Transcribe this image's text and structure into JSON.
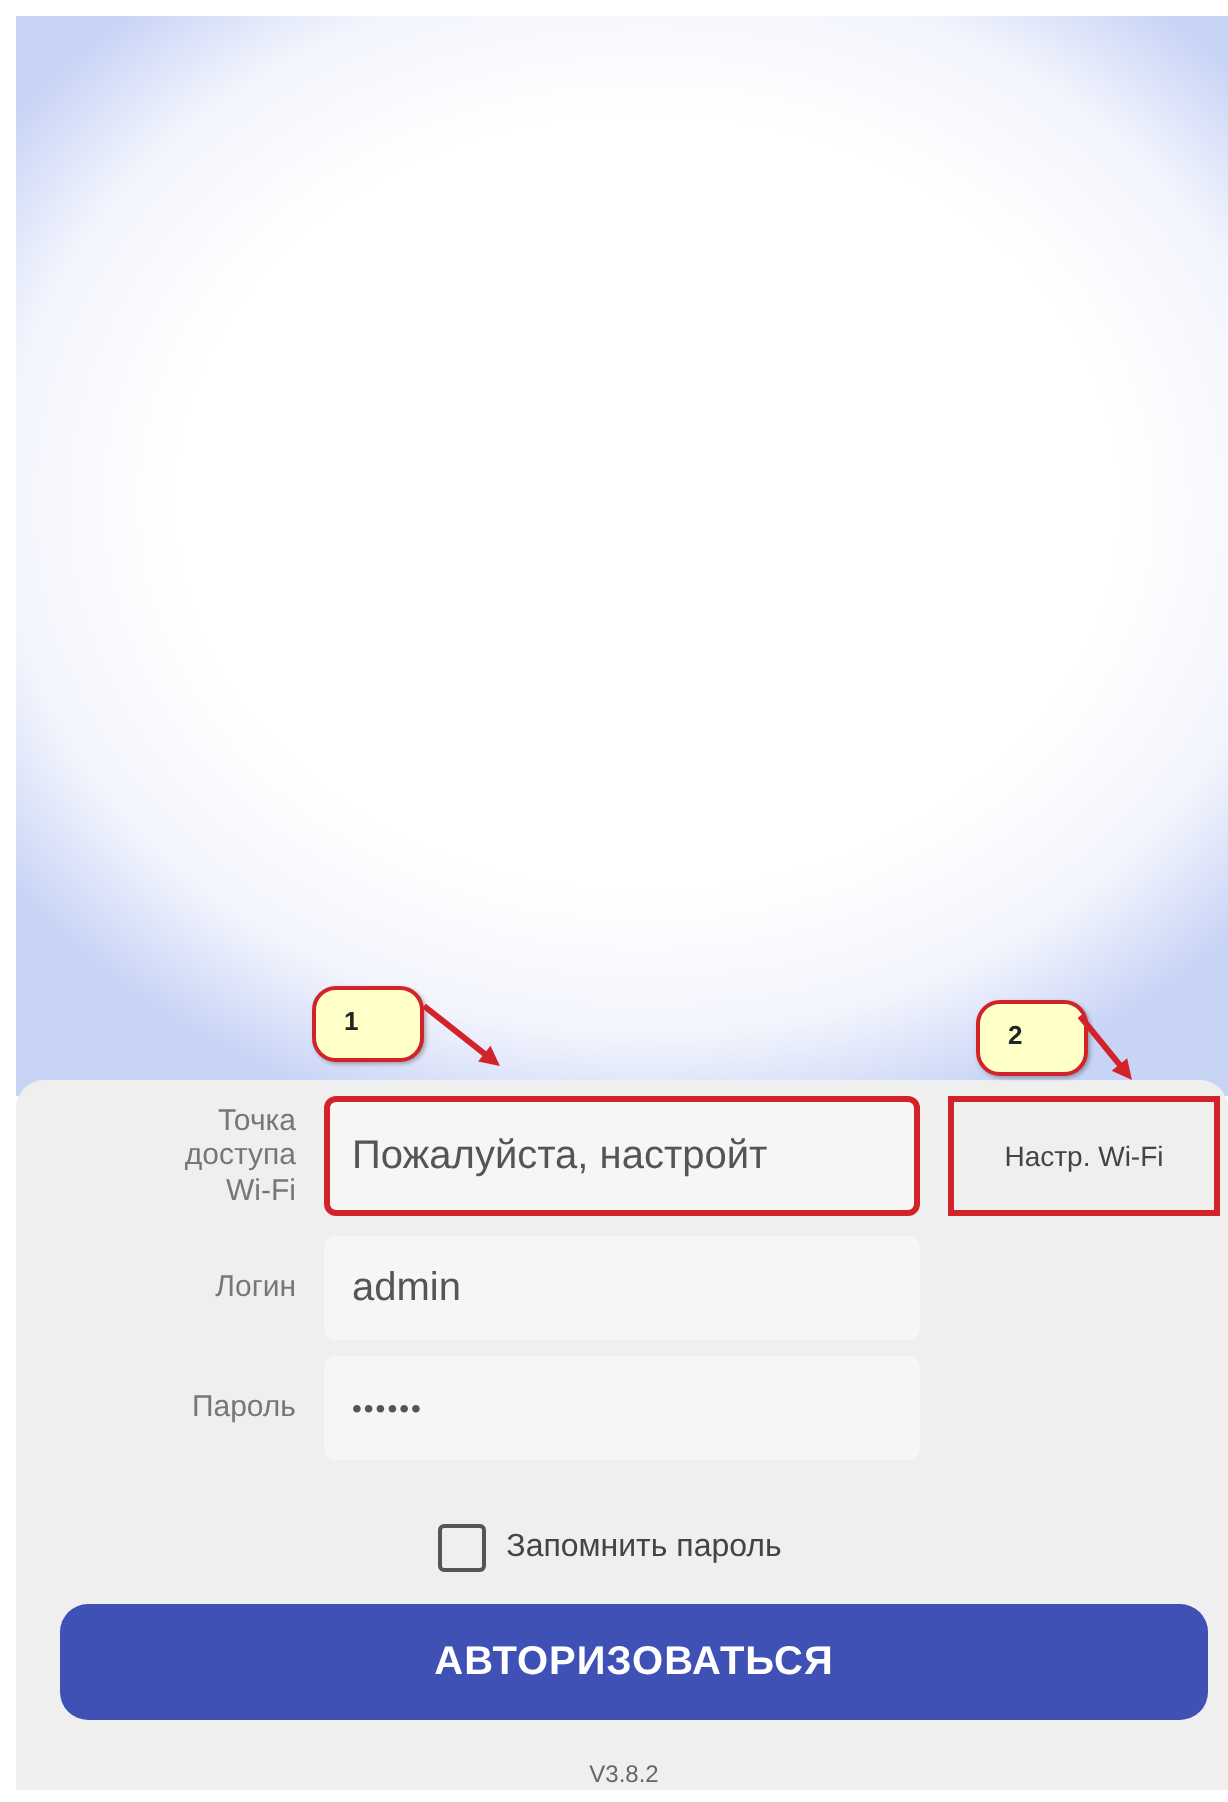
{
  "form": {
    "fields": [
      {
        "label": "Точка доступа Wi-Fi",
        "kind": "text",
        "value": "Пожалуйста, настройт",
        "action": "Настр. Wi-Fi",
        "highlighted": true
      },
      {
        "label": "Логин",
        "kind": "text",
        "value": "admin",
        "highlighted": false
      },
      {
        "label": "Пароль",
        "kind": "password",
        "value": "••••••",
        "highlighted": false
      }
    ],
    "remember": {
      "label": "Запомнить пароль",
      "checked": false
    },
    "submit": "АВТОРИЗОВАТЬСЯ",
    "version": "V3.8.2"
  },
  "annotations": [
    {
      "label": "1",
      "kind": "field"
    },
    {
      "label": "2",
      "kind": "action"
    }
  ]
}
